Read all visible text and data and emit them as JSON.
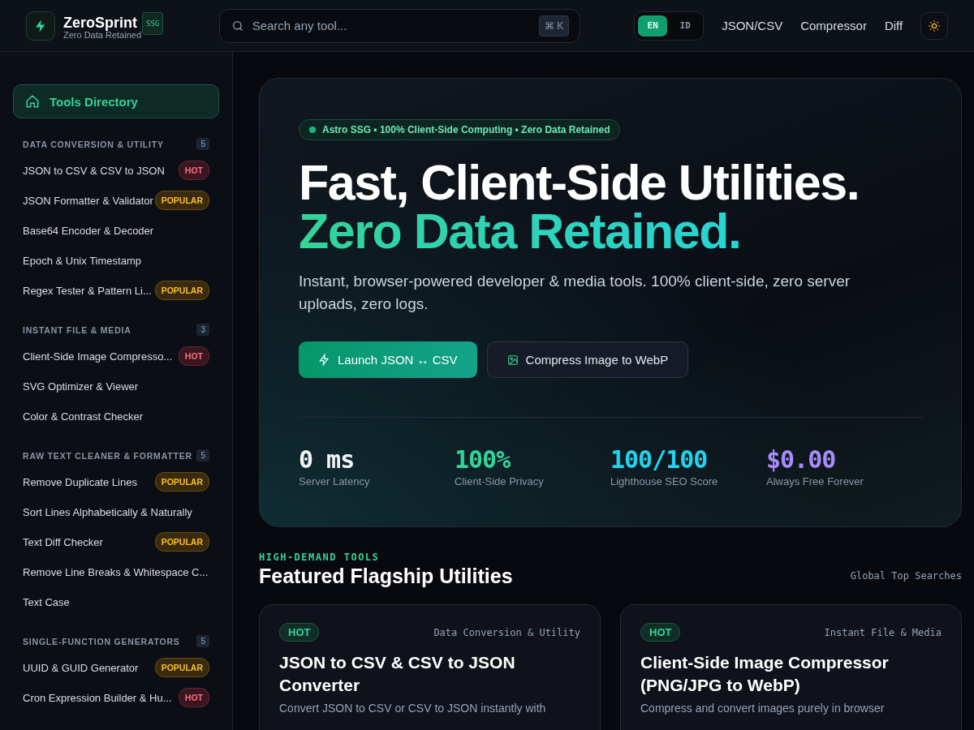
{
  "brand": {
    "name": "ZeroSprint",
    "badge": "SSG",
    "tagline": "Zero Data Retained"
  },
  "search": {
    "placeholder": "Search any tool...",
    "shortcut": [
      "⌘",
      "K"
    ]
  },
  "languages": [
    {
      "label": "EN",
      "selected": true
    },
    {
      "label": "ID",
      "selected": false
    }
  ],
  "nav_links": [
    "JSON/CSV",
    "Compressor",
    "Diff"
  ],
  "sidebar": {
    "home": "Tools Directory",
    "groups": [
      {
        "title": "DATA CONVERSION & UTILITY",
        "count": "5",
        "items": [
          {
            "label": "JSON to CSV & CSV to JSON",
            "badge": "HOT",
            "kind": "hot"
          },
          {
            "label": "JSON Formatter & Validator",
            "badge": "POPULAR",
            "kind": "popular"
          },
          {
            "label": "Base64 Encoder & Decoder"
          },
          {
            "label": "Epoch & Unix Timestamp"
          },
          {
            "label": "Regex Tester & Pattern Li...",
            "badge": "POPULAR",
            "kind": "popular"
          }
        ]
      },
      {
        "title": "INSTANT FILE & MEDIA",
        "count": "3",
        "items": [
          {
            "label": "Client-Side Image Compresso...",
            "badge": "HOT",
            "kind": "hot"
          },
          {
            "label": "SVG Optimizer & Viewer"
          },
          {
            "label": "Color & Contrast Checker"
          }
        ]
      },
      {
        "title": "RAW TEXT CLEANER & FORMATTER",
        "count": "5",
        "items": [
          {
            "label": "Remove Duplicate Lines",
            "badge": "POPULAR",
            "kind": "popular"
          },
          {
            "label": "Sort Lines Alphabetically & Naturally"
          },
          {
            "label": "Text Diff Checker",
            "badge": "POPULAR",
            "kind": "popular"
          },
          {
            "label": "Remove Line Breaks & Whitespace C..."
          },
          {
            "label": "Text Case"
          }
        ]
      },
      {
        "title": "SINGLE-FUNCTION GENERATORS",
        "count": "5",
        "items": [
          {
            "label": "UUID & GUID Generator",
            "badge": "POPULAR",
            "kind": "popular"
          },
          {
            "label": "Cron Expression Builder & Hu...",
            "badge": "HOT",
            "kind": "hot"
          }
        ]
      }
    ]
  },
  "hero": {
    "pill": "Astro SSG • 100% Client-Side Computing • Zero Data Retained",
    "title_line1": "Fast, Client-Side Utilities.",
    "title_line2": "Zero Data Retained.",
    "subtitle": "Instant, browser-powered developer & media tools. 100% client-side, zero server uploads, zero logs.",
    "primary_button": "Launch JSON ↔ CSV",
    "secondary_button": "Compress Image to WebP",
    "stats": [
      {
        "value": "0 ms",
        "label": "Server Latency",
        "color": "#f1f5f9"
      },
      {
        "value": "100%",
        "label": "Client-Side Privacy",
        "color": "#34d399"
      },
      {
        "value": "100/100",
        "label": "Lighthouse SEO Score",
        "color": "#22d3ee"
      },
      {
        "value": "$0.00",
        "label": "Always Free Forever",
        "color": "#a78bfa"
      }
    ]
  },
  "featured": {
    "eyebrow": "HIGH-DEMAND TOOLS",
    "title": "Featured Flagship Utilities",
    "aside": "Global Top Searches",
    "cards": [
      {
        "badge": "HOT",
        "category": "Data Conversion & Utility",
        "title": "JSON to CSV & CSV to JSON Converter",
        "description": "Convert JSON to CSV or CSV to JSON instantly with"
      },
      {
        "badge": "HOT",
        "category": "Instant File & Media",
        "title": "Client-Side Image Compressor (PNG/JPG to WebP)",
        "description": "Compress and convert images purely in browser"
      }
    ]
  }
}
